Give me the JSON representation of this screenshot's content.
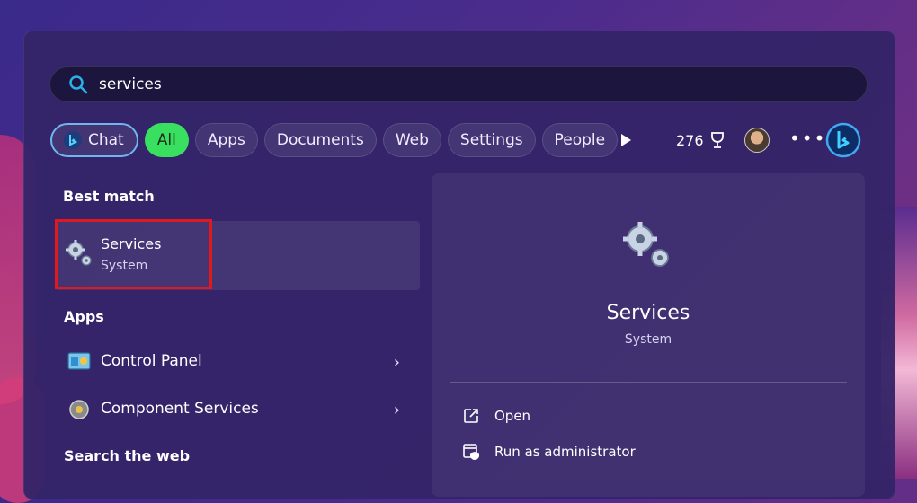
{
  "search": {
    "query": "services"
  },
  "filters": [
    {
      "label": "Chat"
    },
    {
      "label": "All"
    },
    {
      "label": "Apps"
    },
    {
      "label": "Documents"
    },
    {
      "label": "Web"
    },
    {
      "label": "Settings"
    },
    {
      "label": "People"
    }
  ],
  "rewards": {
    "points": "276"
  },
  "best_match": {
    "heading": "Best match",
    "title": "Services",
    "subtitle": "System"
  },
  "apps": {
    "heading": "Apps",
    "items": [
      {
        "label": "Control Panel",
        "icon": "control-panel-icon"
      },
      {
        "label": "Component Services",
        "icon": "component-services-icon"
      }
    ]
  },
  "search_web": {
    "heading": "Search the web"
  },
  "preview": {
    "title": "Services",
    "subtitle": "System",
    "actions": [
      {
        "label": "Open",
        "icon": "open-external-icon"
      },
      {
        "label": "Run as administrator",
        "icon": "shield-admin-icon"
      }
    ]
  },
  "colors": {
    "accent_green": "#39e05f",
    "highlight_red": "#e0191c",
    "chat_border": "#6fb6f0"
  }
}
